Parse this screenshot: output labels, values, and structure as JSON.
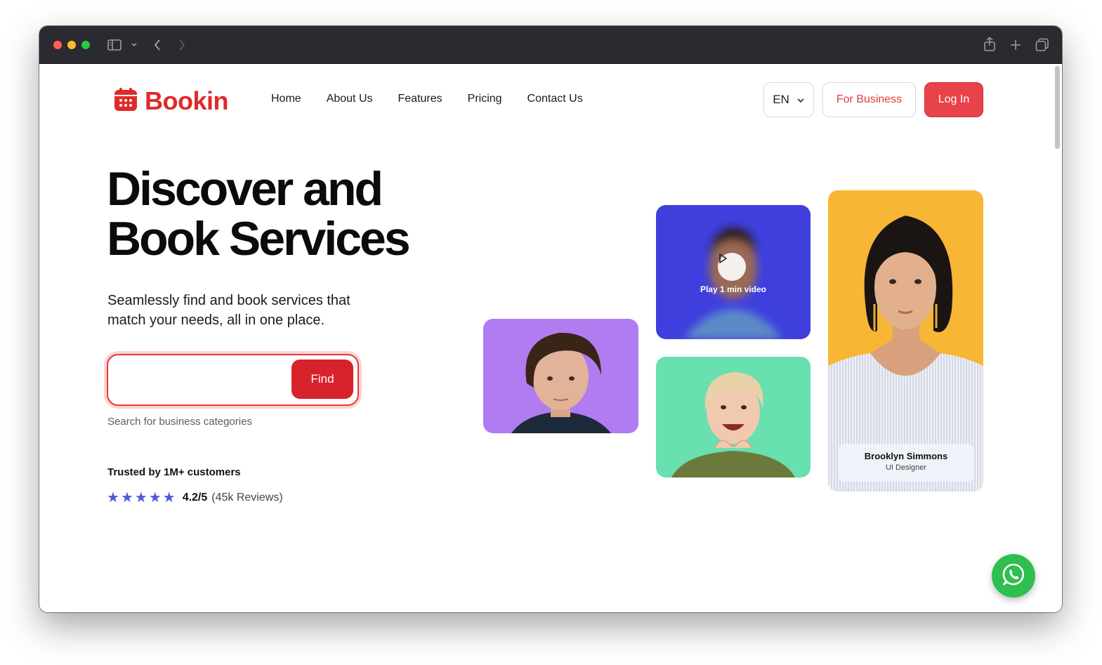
{
  "brand": {
    "name": "Bookin",
    "color": "#e02a2a"
  },
  "nav": {
    "items": [
      "Home",
      "About Us",
      "Features",
      "Pricing",
      "Contact Us"
    ]
  },
  "header": {
    "language": "EN",
    "business_label": "For Business",
    "login_label": "Log In"
  },
  "hero": {
    "title_line1": "Discover and",
    "title_line2": "Book Services",
    "subtitle": "Seamlessly find and book services that match your needs, all in one place.",
    "search": {
      "value": "",
      "placeholder": "",
      "button_label": "Find",
      "hint": "Search for business categories"
    },
    "trusted_label": "Trusted by 1M+ customers",
    "rating": {
      "stars": 5,
      "score": "4.2/5",
      "reviews": "(45k Reviews)",
      "star_color": "#4f5bd5"
    }
  },
  "cards": {
    "video_label": "Play 1 min video",
    "profile_name": "Brooklyn Simmons",
    "profile_role": "UI Designer",
    "colors": {
      "purple": "#b07cf0",
      "blue": "#3f3fdd",
      "green": "#68e0b0",
      "yellow": "#f7b634"
    }
  },
  "icons": [
    "sidebar-icon",
    "chevron-down-icon",
    "back-arrow-icon",
    "forward-arrow-icon",
    "share-icon",
    "plus-icon",
    "tabs-icon",
    "calendar-logo-icon",
    "play-icon",
    "star-icon",
    "whatsapp-icon"
  ]
}
